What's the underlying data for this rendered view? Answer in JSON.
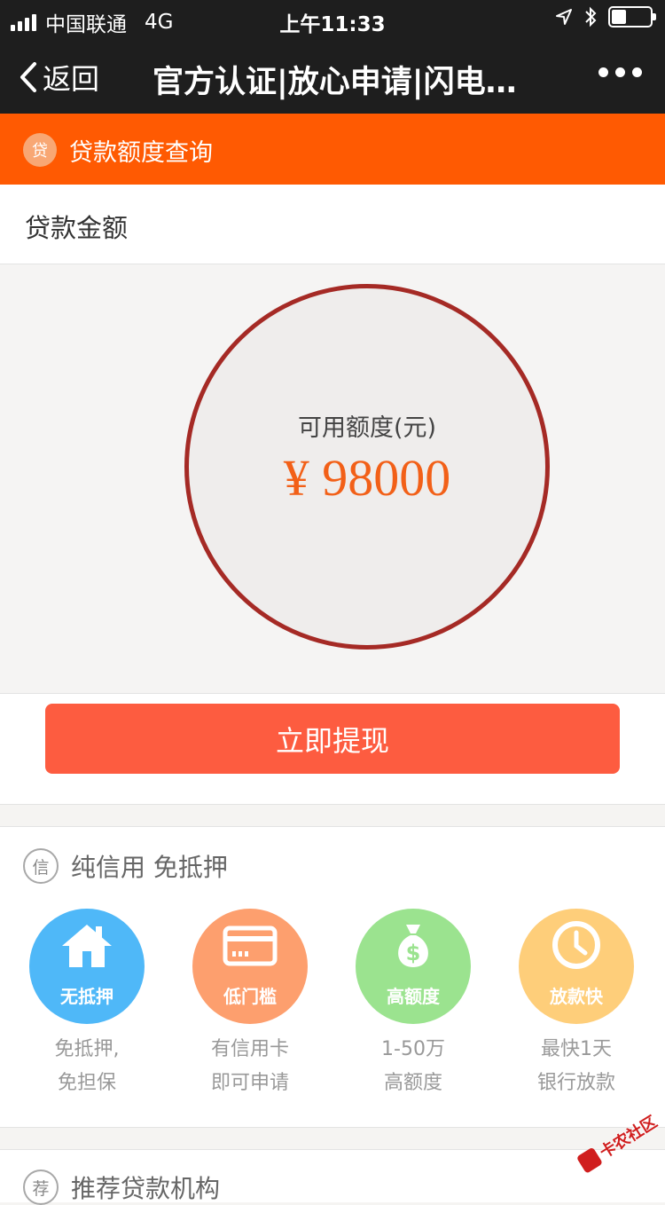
{
  "status_bar": {
    "carrier": "中国联通",
    "network": "4G",
    "time": "上午11:33"
  },
  "nav": {
    "back_label": "返回",
    "title": "官方认证|放心申请|闪电…"
  },
  "banner": {
    "badge": "贷",
    "title": "贷款额度查询"
  },
  "amount": {
    "label": "贷款金额"
  },
  "quota": {
    "label": "可用额度(元)",
    "value": "¥ 98000"
  },
  "withdraw_button": {
    "label": "立即提现"
  },
  "credit_section": {
    "badge": "信",
    "title": "纯信用 免抵押",
    "features": [
      {
        "icon": "house-icon",
        "tag": "无抵押",
        "line1": "免抵押,",
        "line2": "免担保",
        "color": "#4fb8f8"
      },
      {
        "icon": "card-icon",
        "tag": "低门槛",
        "line1": "有信用卡",
        "line2": "即可申请",
        "color": "#fd9f6e"
      },
      {
        "icon": "money-bag-icon",
        "tag": "高额度",
        "line1": "1-50万",
        "line2": "高额度",
        "color": "#9be38f"
      },
      {
        "icon": "clock-icon",
        "tag": "放款快",
        "line1": "最快1天",
        "line2": "银行放款",
        "color": "#fece7a"
      }
    ]
  },
  "recommend_section": {
    "badge": "荐",
    "title": "推荐贷款机构"
  },
  "watermark": {
    "text": "卡农社区"
  },
  "colors": {
    "nav_bg": "#1e1e1e",
    "banner": "#ff5a02",
    "button": "#fd5c40",
    "circle_border": "#a52a25",
    "amount": "#f26018"
  }
}
